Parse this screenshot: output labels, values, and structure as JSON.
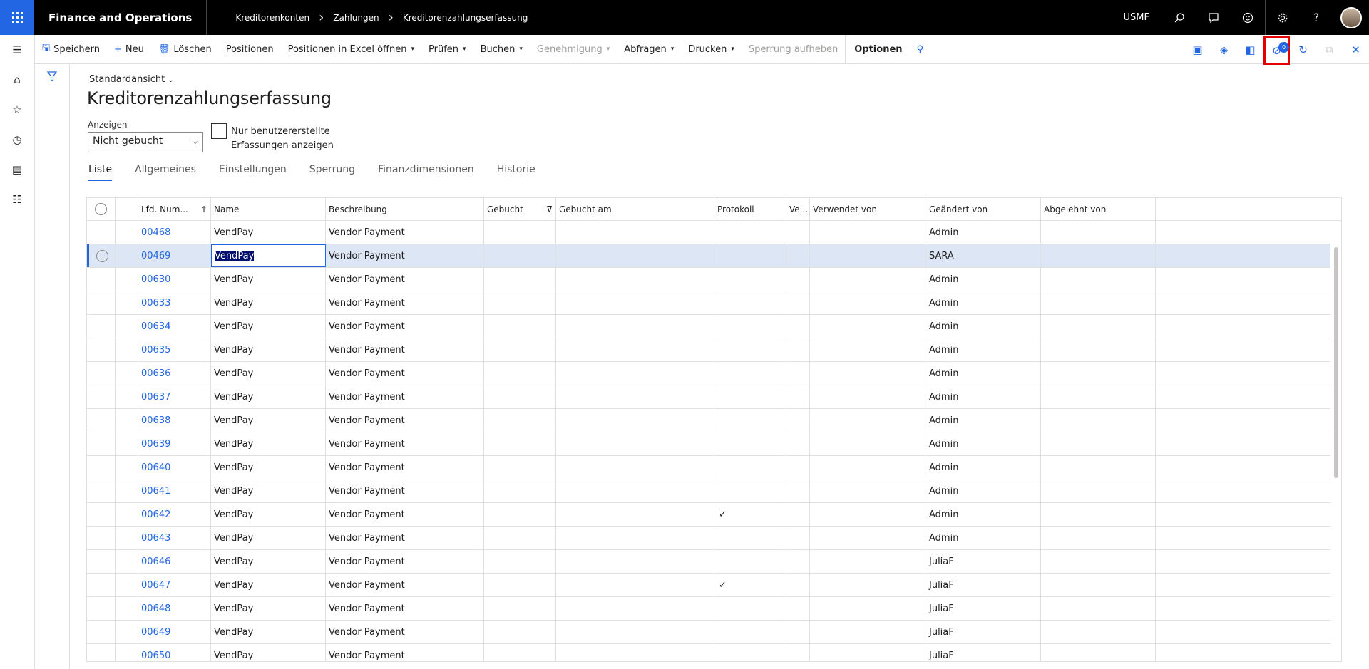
{
  "topbar": {
    "app_name": "Finance and Operations",
    "breadcrumbs": [
      "Kreditorenkonten",
      "Zahlungen",
      "Kreditorenzahlungserfassung"
    ],
    "company": "USMF"
  },
  "actions": {
    "save": "Speichern",
    "new": "Neu",
    "delete": "Löschen",
    "lines": "Positionen",
    "open_excel": "Positionen in Excel öffnen",
    "validate": "Prüfen",
    "post": "Buchen",
    "approval": "Genehmigung",
    "inquiries": "Abfragen",
    "print": "Drucken",
    "unlock": "Sperrung aufheben",
    "options": "Optionen",
    "notification_count": "0"
  },
  "page": {
    "view_name": "Standardansicht",
    "title": "Kreditorenzahlungserfassung",
    "show_label": "Anzeigen",
    "show_value": "Nicht gebucht",
    "checkbox_label": "Nur benutzererstellte Erfassungen anzeigen",
    "tabs": [
      "Liste",
      "Allgemeines",
      "Einstellungen",
      "Sperrung",
      "Finanzdimensionen",
      "Historie"
    ]
  },
  "grid": {
    "columns": [
      "Lfd. Num...",
      "Name",
      "Beschreibung",
      "Gebucht",
      "Gebucht am",
      "Protokoll",
      "Ve...",
      "Verwendet von",
      "Geändert von",
      "Abgelehnt von"
    ],
    "rows": [
      {
        "num": "00468",
        "name": "VendPay",
        "desc": "Vendor Payment",
        "protokoll": "",
        "changed_by": "Admin"
      },
      {
        "num": "00469",
        "name": "VendPay",
        "desc": "Vendor Payment",
        "protokoll": "",
        "changed_by": "SARA"
      },
      {
        "num": "00630",
        "name": "VendPay",
        "desc": "Vendor Payment",
        "protokoll": "",
        "changed_by": "Admin"
      },
      {
        "num": "00633",
        "name": "VendPay",
        "desc": "Vendor Payment",
        "protokoll": "",
        "changed_by": "Admin"
      },
      {
        "num": "00634",
        "name": "VendPay",
        "desc": "Vendor Payment",
        "protokoll": "",
        "changed_by": "Admin"
      },
      {
        "num": "00635",
        "name": "VendPay",
        "desc": "Vendor Payment",
        "protokoll": "",
        "changed_by": "Admin"
      },
      {
        "num": "00636",
        "name": "VendPay",
        "desc": "Vendor Payment",
        "protokoll": "",
        "changed_by": "Admin"
      },
      {
        "num": "00637",
        "name": "VendPay",
        "desc": "Vendor Payment",
        "protokoll": "",
        "changed_by": "Admin"
      },
      {
        "num": "00638",
        "name": "VendPay",
        "desc": "Vendor Payment",
        "protokoll": "",
        "changed_by": "Admin"
      },
      {
        "num": "00639",
        "name": "VendPay",
        "desc": "Vendor Payment",
        "protokoll": "",
        "changed_by": "Admin"
      },
      {
        "num": "00640",
        "name": "VendPay",
        "desc": "Vendor Payment",
        "protokoll": "",
        "changed_by": "Admin"
      },
      {
        "num": "00641",
        "name": "VendPay",
        "desc": "Vendor Payment",
        "protokoll": "",
        "changed_by": "Admin"
      },
      {
        "num": "00642",
        "name": "VendPay",
        "desc": "Vendor Payment",
        "protokoll": "✓",
        "changed_by": "Admin"
      },
      {
        "num": "00643",
        "name": "VendPay",
        "desc": "Vendor Payment",
        "protokoll": "",
        "changed_by": "Admin"
      },
      {
        "num": "00646",
        "name": "VendPay",
        "desc": "Vendor Payment",
        "protokoll": "",
        "changed_by": "JuliaF"
      },
      {
        "num": "00647",
        "name": "VendPay",
        "desc": "Vendor Payment",
        "protokoll": "✓",
        "changed_by": "JuliaF"
      },
      {
        "num": "00648",
        "name": "VendPay",
        "desc": "Vendor Payment",
        "protokoll": "",
        "changed_by": "JuliaF"
      },
      {
        "num": "00649",
        "name": "VendPay",
        "desc": "Vendor Payment",
        "protokoll": "",
        "changed_by": "JuliaF"
      },
      {
        "num": "00650",
        "name": "VendPay",
        "desc": "Vendor Payment",
        "protokoll": "",
        "changed_by": "JuliaF"
      }
    ],
    "selected_row": 1
  },
  "colors": {
    "accent": "#2266e3",
    "highlight_box": "#e30000",
    "selected_row": "#dde6f5"
  }
}
